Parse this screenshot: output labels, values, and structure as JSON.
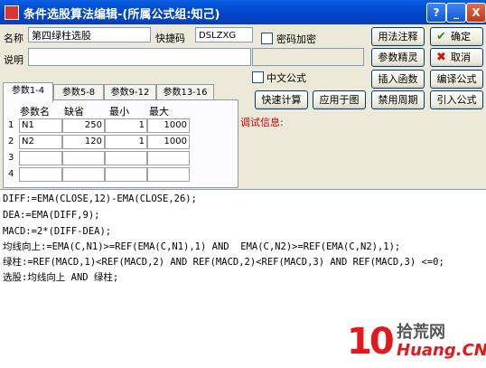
{
  "window": {
    "title": "条件选股算法编辑-(所属公式组:知己)",
    "help_btn": "?",
    "min_btn": "_",
    "max_btn": "□",
    "close_btn": "X"
  },
  "form": {
    "name_label": "名称",
    "name_value": "第四绿柱选股",
    "shortcut_label": "快捷码",
    "shortcut_value": "DSLZXG",
    "password_label": "密码加密",
    "desc_label": "说明",
    "desc_value": "",
    "chinese_formula_label": "中文公式"
  },
  "buttons": {
    "usage_notes": "用法注释",
    "ok": "确定",
    "param_wizard": "参数精灵",
    "cancel": "取消",
    "insert_func": "插入函数",
    "compile": "编译公式",
    "quick_calc": "快速计算",
    "apply_chart": "应用于图",
    "disable_period": "禁用周期",
    "import_formula": "引入公式"
  },
  "debug_label": "调试信息:",
  "tabs": [
    "参数1-4",
    "参数5-8",
    "参数9-12",
    "参数13-16"
  ],
  "params": {
    "headers": [
      "参数名",
      "缺省",
      "最小",
      "最大"
    ],
    "rows": [
      {
        "no": "1",
        "name": "N1",
        "default": "250",
        "min": "1",
        "max": "1000"
      },
      {
        "no": "2",
        "name": "N2",
        "default": "120",
        "min": "1",
        "max": "1000"
      },
      {
        "no": "3",
        "name": "",
        "default": "",
        "min": "",
        "max": ""
      },
      {
        "no": "4",
        "name": "",
        "default": "",
        "min": "",
        "max": ""
      }
    ]
  },
  "code_lines": [
    "DIFF:=EMA(CLOSE,12)-EMA(CLOSE,26);",
    "DEA:=EMA(DIFF,9);",
    "MACD:=2*(DIFF-DEA);",
    "均线向上:=EMA(C,N1)>=REF(EMA(C,N1),1) AND  EMA(C,N2)>=REF(EMA(C,N2),1);",
    "绿柱:=REF(MACD,1)<REF(MACD,2) AND REF(MACD,2)<REF(MACD,3) AND REF(MACD,3) <=0;",
    "选股:均线向上 AND 绿柱;"
  ],
  "watermark": {
    "num": "10",
    "top": "拾荒网",
    "bottom": "Huang.CN"
  }
}
